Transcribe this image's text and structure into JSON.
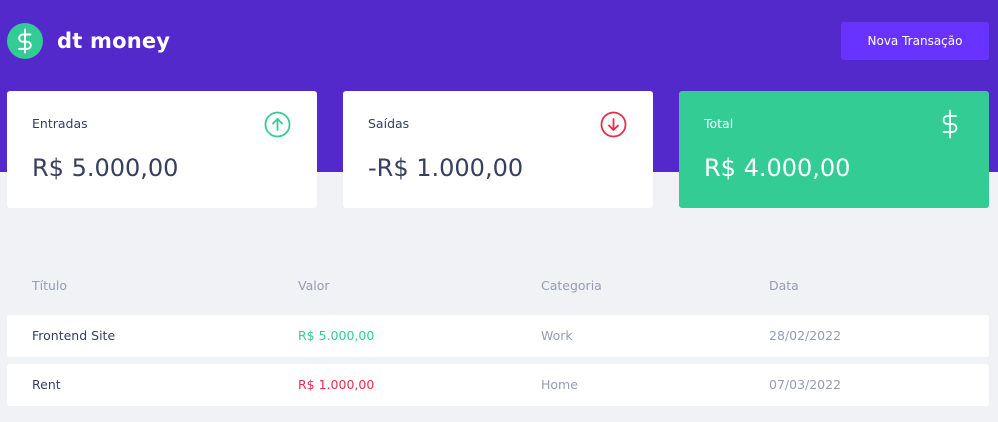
{
  "app": {
    "name": "dt money"
  },
  "header": {
    "new_transaction_label": "Nova Transação"
  },
  "summary": {
    "income": {
      "label": "Entradas",
      "value": "R$ 5.000,00",
      "icon": "arrow-up-circle-icon"
    },
    "outcome": {
      "label": "Saídas",
      "value": "-R$ 1.000,00",
      "icon": "arrow-down-circle-icon"
    },
    "total": {
      "label": "Total",
      "value": "R$ 4.000,00",
      "icon": "dollar-icon"
    }
  },
  "table": {
    "headers": [
      "Título",
      "Valor",
      "Categoria",
      "Data"
    ],
    "rows": [
      {
        "title": "Frontend Site",
        "amount": "R$ 5.000,00",
        "type": "deposit",
        "category": "Work",
        "date": "28/02/2022"
      },
      {
        "title": "Rent",
        "amount": "R$ 1.000,00",
        "type": "withdraw",
        "category": "Home",
        "date": "07/03/2022"
      }
    ]
  },
  "colors": {
    "header": "#5429cc",
    "button": "#6933ff",
    "green": "#33cc95",
    "red": "#e52e4d",
    "text_title": "#363f5f",
    "text_body": "#969cb3",
    "background": "#f0f2f5"
  }
}
